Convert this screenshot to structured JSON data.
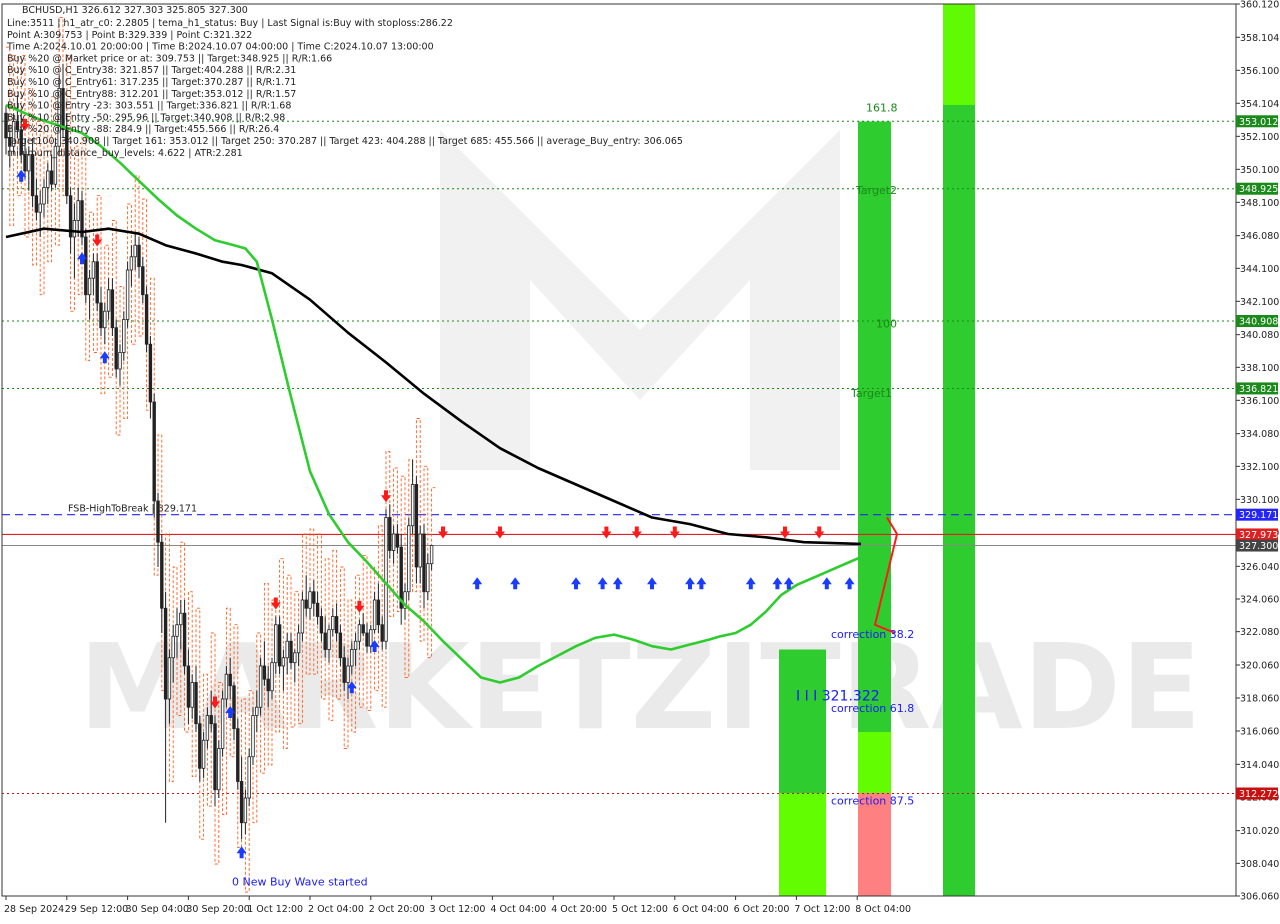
{
  "header": {
    "symbol_line": "BCHUSD,H1  326.612 327.303 325.805 327.300",
    "info_lines": [
      "Line:3511  |  h1_atr_c0: 2.2805  |  tema_h1_status: Buy  |  Last Signal is:Buy with stoploss:286.22",
      "Point A:309.753  |  Point B:329.339  |  Point C:321.322",
      "Time A:2024.10.01 20:00:00  |  Time B:2024.10.07 04:00:00  |  Time C:2024.10.07 13:00:00",
      "Buy %20 @ Market price or at: 309.753  ||  Target:348.925  ||  R/R:1.66",
      "Buy %10 @ C_Entry38: 321.857  ||  Target:404.288  ||  R/R:2.31",
      "Buy %10 @ C_Entry61: 317.235  ||  Target:370.287  ||  R/R:1.71",
      "Buy %10 @ C_Entry88: 312.201  ||  Target:353.012  ||  R/R:1.57",
      "Buy %10 @ Entry -23: 303.551  ||  Target:336.821  ||  R/R:1.68",
      "Buy %10 @ Entry -50: 295.96  ||  Target:340.908  ||  R/R:2.98",
      "Buy %20 @ Entry -88: 284.9  ||  Target:455.566  ||  R/R:26.4",
      "Target100: 340.908  ||  Target 161: 353.012  ||  Target 250: 370.287  ||  Target 423: 404.288  ||  Target 685: 455.566  ||  average_Buy_entry: 306.065",
      "minimum_distance_buy_levels: 4.622  |  ATR:2.281"
    ]
  },
  "colors": {
    "up_candle": "#222222",
    "down_candle": "#222222",
    "ma_slow": "#000000",
    "ma_fast": "#2ecc2e",
    "stop_line": "#ff6020",
    "buy_arrow": "#1a3cff",
    "sell_arrow": "#ff1a1a",
    "level_green": "#1a8a1a",
    "level_red": "#c81010",
    "fsb_line": "#2424ff",
    "current_line": "#888888",
    "zone_green": "#2ecc2e",
    "zone_lime": "#66ff00",
    "zone_pink": "#ff8080",
    "watermark": "#d8d8d8"
  },
  "watermark": "MARKETZITRADE",
  "chart_data": {
    "type": "candlestick",
    "symbol": "BCHUSD",
    "timeframe": "H1",
    "ohlc_last": {
      "open": 326.612,
      "high": 327.303,
      "low": 325.805,
      "close": 327.3
    },
    "ylim": [
      306.06,
      360.12
    ],
    "y_ticks": [
      360.12,
      358.104,
      356.1,
      354.104,
      352.1,
      350.1,
      348.1,
      346.08,
      344.1,
      342.1,
      340.08,
      338.1,
      336.1,
      334.08,
      332.1,
      330.1,
      328.1,
      326.04,
      324.06,
      322.08,
      320.06,
      318.06,
      316.06,
      314.04,
      312.06,
      310.02,
      308.04,
      306.06
    ],
    "y_tick_labels": [
      "360.120",
      "358.104",
      "356.100",
      "354.104",
      "352.100",
      "350.100",
      "348.100",
      "346.080",
      "344.100",
      "342.100",
      "340.080",
      "338.100",
      "336.100",
      "334.080",
      "332.100",
      "330.100",
      "328.100",
      "326.040",
      "324.060",
      "322.080",
      "320.060",
      "318.060",
      "316.060",
      "314.040",
      "312.060",
      "310.020",
      "308.040",
      "306.060"
    ],
    "x_labels": [
      "28 Sep 2024",
      "29 Sep 12:00",
      "30 Sep 04:00",
      "30 Sep 20:00",
      "1 Oct 12:00",
      "2 Oct 04:00",
      "2 Oct 20:00",
      "3 Oct 12:00",
      "4 Oct 04:00",
      "4 Oct 20:00",
      "5 Oct 12:00",
      "6 Oct 04:00",
      "6 Oct 20:00",
      "7 Oct 12:00",
      "8 Oct 04:00"
    ],
    "x_label_positions": [
      0,
      16,
      32,
      48,
      64,
      80,
      96,
      112,
      128,
      144,
      160,
      176,
      192,
      208,
      224
    ],
    "candles": [
      [
        353.5,
        354.0,
        351.0,
        352.0
      ],
      [
        352.0,
        352.8,
        350.2,
        351.5
      ],
      [
        351.5,
        353.5,
        351.0,
        353.0
      ],
      [
        353.0,
        354.6,
        352.0,
        352.5
      ],
      [
        352.5,
        353.5,
        350.5,
        351.0
      ],
      [
        351.0,
        352.0,
        349.5,
        350.0
      ],
      [
        350.0,
        351.5,
        348.8,
        351.0
      ],
      [
        351.0,
        352.0,
        347.8,
        348.5
      ],
      [
        348.5,
        349.5,
        347.0,
        347.5
      ],
      [
        347.5,
        348.8,
        346.0,
        348.0
      ],
      [
        348.0,
        349.5,
        347.2,
        349.0
      ],
      [
        349.0,
        350.5,
        348.0,
        350.0
      ],
      [
        350.0,
        351.0,
        348.8,
        349.2
      ],
      [
        349.2,
        352.0,
        349.0,
        351.5
      ],
      [
        351.5,
        355.8,
        351.0,
        355.0
      ],
      [
        355.0,
        356.5,
        352.0,
        352.5
      ],
      [
        352.5,
        353.5,
        348.0,
        348.5
      ],
      [
        348.5,
        349.0,
        345.0,
        346.0
      ],
      [
        346.0,
        348.0,
        343.5,
        347.0
      ],
      [
        347.0,
        349.0,
        346.0,
        348.2
      ],
      [
        348.2,
        348.8,
        345.5,
        346.0
      ],
      [
        346.0,
        346.5,
        342.0,
        342.5
      ],
      [
        342.5,
        344.0,
        341.0,
        343.5
      ],
      [
        343.5,
        345.0,
        342.5,
        344.5
      ],
      [
        344.5,
        345.0,
        341.5,
        342.0
      ],
      [
        342.0,
        343.0,
        340.0,
        340.5
      ],
      [
        340.5,
        342.0,
        339.5,
        341.5
      ],
      [
        341.5,
        343.5,
        341.0,
        342.8
      ],
      [
        342.8,
        343.5,
        340.0,
        340.5
      ],
      [
        340.5,
        341.0,
        337.5,
        338.0
      ],
      [
        338.0,
        339.5,
        337.0,
        339.0
      ],
      [
        339.0,
        341.5,
        338.5,
        341.0
      ],
      [
        341.0,
        344.5,
        340.5,
        344.0
      ],
      [
        344.0,
        345.5,
        343.0,
        344.8
      ],
      [
        344.8,
        346.2,
        344.0,
        345.5
      ],
      [
        345.5,
        346.0,
        343.5,
        344.2
      ],
      [
        344.2,
        344.8,
        342.0,
        342.5
      ],
      [
        342.5,
        343.0,
        339.0,
        339.5
      ],
      [
        339.5,
        340.0,
        335.0,
        336.0
      ],
      [
        336.0,
        336.5,
        329.0,
        330.0
      ],
      [
        330.0,
        330.5,
        326.0,
        327.5
      ],
      [
        327.5,
        328.0,
        322.0,
        323.5
      ],
      [
        323.5,
        324.5,
        310.5,
        318.0
      ],
      [
        318.0,
        321.0,
        316.5,
        320.5
      ],
      [
        320.5,
        322.5,
        319.0,
        321.8
      ],
      [
        321.8,
        323.5,
        320.5,
        322.5
      ],
      [
        322.5,
        324.0,
        321.0,
        323.2
      ],
      [
        323.2,
        324.0,
        319.5,
        320.0
      ],
      [
        320.0,
        321.0,
        316.5,
        317.5
      ],
      [
        317.5,
        319.5,
        316.8,
        319.0
      ],
      [
        319.0,
        320.0,
        316.0,
        316.5
      ],
      [
        316.5,
        317.0,
        313.0,
        313.8
      ],
      [
        313.8,
        316.0,
        313.2,
        315.5
      ],
      [
        315.5,
        317.5,
        315.0,
        317.0
      ],
      [
        317.0,
        318.5,
        316.0,
        316.5
      ],
      [
        316.5,
        317.0,
        311.5,
        312.5
      ],
      [
        312.5,
        315.5,
        312.0,
        315.0
      ],
      [
        315.0,
        318.5,
        314.5,
        318.0
      ],
      [
        318.0,
        320.0,
        317.5,
        319.5
      ],
      [
        319.5,
        320.5,
        318.0,
        318.8
      ],
      [
        318.8,
        319.0,
        315.5,
        316.2
      ],
      [
        316.2,
        316.8,
        312.5,
        313.0
      ],
      [
        313.0,
        314.5,
        309.5,
        310.5
      ],
      [
        310.5,
        312.5,
        309.8,
        312.0
      ],
      [
        312.0,
        315.0,
        311.5,
        314.5
      ],
      [
        314.5,
        317.5,
        314.0,
        317.0
      ],
      [
        317.0,
        318.5,
        316.0,
        317.5
      ],
      [
        317.5,
        320.5,
        317.0,
        320.0
      ],
      [
        320.0,
        321.5,
        318.8,
        319.2
      ],
      [
        319.2,
        320.0,
        317.5,
        318.5
      ],
      [
        318.5,
        320.5,
        318.0,
        320.2
      ],
      [
        320.2,
        323.0,
        319.5,
        322.5
      ],
      [
        322.5,
        323.0,
        319.5,
        320.0
      ],
      [
        320.0,
        321.0,
        318.5,
        320.5
      ],
      [
        320.5,
        322.0,
        319.5,
        321.5
      ],
      [
        321.5,
        322.0,
        319.8,
        320.2
      ],
      [
        320.2,
        321.0,
        319.0,
        320.8
      ],
      [
        320.8,
        322.5,
        320.0,
        322.0
      ],
      [
        322.0,
        324.5,
        321.5,
        324.0
      ],
      [
        324.0,
        325.5,
        323.0,
        323.5
      ],
      [
        323.5,
        324.8,
        322.8,
        324.5
      ],
      [
        324.5,
        325.2,
        323.0,
        323.8
      ],
      [
        323.8,
        324.5,
        322.5,
        323.0
      ],
      [
        323.0,
        323.5,
        321.5,
        322.0
      ],
      [
        322.0,
        323.0,
        320.5,
        321.0
      ],
      [
        321.0,
        322.5,
        320.2,
        322.2
      ],
      [
        322.2,
        323.5,
        321.8,
        323.0
      ],
      [
        323.0,
        323.8,
        321.5,
        322.0
      ],
      [
        322.0,
        322.5,
        320.0,
        320.5
      ],
      [
        320.5,
        321.2,
        318.5,
        319.0
      ],
      [
        319.0,
        320.5,
        318.0,
        320.0
      ],
      [
        320.0,
        321.5,
        319.5,
        321.0
      ],
      [
        321.0,
        322.0,
        320.0,
        321.5
      ],
      [
        321.5,
        322.8,
        321.0,
        322.5
      ],
      [
        322.5,
        323.2,
        321.8,
        322.0
      ],
      [
        322.0,
        322.6,
        320.8,
        321.2
      ],
      [
        321.2,
        322.5,
        320.8,
        322.2
      ],
      [
        322.2,
        324.5,
        322.0,
        324.0
      ],
      [
        324.0,
        325.0,
        322.0,
        322.5
      ],
      [
        322.5,
        323.0,
        321.0,
        321.5
      ],
      [
        321.5,
        329.5,
        321.0,
        329.0
      ],
      [
        329.0,
        329.8,
        326.5,
        327.0
      ],
      [
        327.0,
        328.5,
        326.2,
        328.0
      ],
      [
        328.0,
        328.6,
        326.8,
        327.2
      ],
      [
        327.2,
        328.0,
        322.5,
        323.5
      ],
      [
        323.5,
        325.0,
        322.8,
        324.5
      ],
      [
        324.5,
        329.0,
        324.0,
        328.5
      ],
      [
        328.5,
        332.5,
        328.0,
        331.0
      ],
      [
        331.0,
        331.5,
        325.0,
        326.0
      ],
      [
        326.0,
        328.5,
        325.0,
        328.0
      ],
      [
        328.0,
        328.6,
        323.5,
        324.5
      ],
      [
        324.5,
        326.8,
        324.0,
        326.2
      ],
      [
        326.2,
        327.303,
        325.805,
        327.3
      ]
    ],
    "ma_slow_points": [
      [
        0,
        346.0
      ],
      [
        10,
        346.5
      ],
      [
        20,
        346.3
      ],
      [
        27,
        346.5
      ],
      [
        35,
        346.2
      ],
      [
        42,
        345.5
      ],
      [
        50,
        345.0
      ],
      [
        57,
        344.5
      ],
      [
        62,
        344.3
      ],
      [
        70,
        343.8
      ],
      [
        80,
        342.2
      ],
      [
        90,
        340.2
      ],
      [
        100,
        338.4
      ],
      [
        110,
        336.5
      ],
      [
        120,
        334.8
      ],
      [
        130,
        333.2
      ],
      [
        140,
        332.0
      ],
      [
        150,
        331.0
      ],
      [
        160,
        330.0
      ],
      [
        170,
        329.0
      ],
      [
        180,
        328.6
      ],
      [
        190,
        328.0
      ],
      [
        200,
        327.8
      ],
      [
        210,
        327.5
      ],
      [
        225,
        327.4
      ]
    ],
    "ma_fast_points": [
      [
        0,
        354.0
      ],
      [
        8,
        353.2
      ],
      [
        16,
        352.6
      ],
      [
        20,
        352.3
      ],
      [
        25,
        351.5
      ],
      [
        30,
        350.5
      ],
      [
        35,
        349.4
      ],
      [
        40,
        348.3
      ],
      [
        45,
        347.3
      ],
      [
        50,
        346.5
      ],
      [
        55,
        345.8
      ],
      [
        60,
        345.5
      ],
      [
        63,
        345.3
      ],
      [
        66,
        344.5
      ],
      [
        70,
        341.0
      ],
      [
        75,
        336.3
      ],
      [
        80,
        331.8
      ],
      [
        85,
        329.2
      ],
      [
        90,
        327.5
      ],
      [
        95,
        326.3
      ],
      [
        100,
        325.0
      ],
      [
        105,
        323.7
      ],
      [
        110,
        322.7
      ],
      [
        115,
        321.5
      ],
      [
        120,
        320.4
      ],
      [
        125,
        319.3
      ],
      [
        130,
        319.0
      ],
      [
        135,
        319.3
      ],
      [
        140,
        320.0
      ],
      [
        145,
        320.6
      ],
      [
        150,
        321.2
      ],
      [
        155,
        321.7
      ],
      [
        160,
        321.9
      ],
      [
        165,
        321.6
      ],
      [
        170,
        321.2
      ],
      [
        175,
        321.0
      ],
      [
        180,
        321.3
      ],
      [
        185,
        321.6
      ],
      [
        188,
        321.8
      ],
      [
        192,
        322.0
      ],
      [
        196,
        322.5
      ],
      [
        200,
        323.3
      ],
      [
        204,
        324.3
      ],
      [
        208,
        324.9
      ],
      [
        212,
        325.3
      ],
      [
        215,
        325.6
      ],
      [
        218,
        325.9
      ],
      [
        222,
        326.3
      ],
      [
        225,
        326.6
      ]
    ],
    "levels": [
      {
        "price": 353.012,
        "label": "353.012",
        "kind": "target"
      },
      {
        "price": 348.925,
        "label": "348.925",
        "kind": "target"
      },
      {
        "price": 340.908,
        "label": "340.908",
        "kind": "target"
      },
      {
        "price": 336.821,
        "label": "336.821",
        "kind": "target"
      },
      {
        "price": 312.272,
        "label": "312.272",
        "kind": "stop"
      }
    ],
    "fsb_level": {
      "price": 329.171,
      "label": "329.171",
      "text": "FSB-HighToBreak | 329.171"
    },
    "red_level": {
      "price": 327.973,
      "label": "327.973"
    },
    "current_price": {
      "price": 327.3,
      "label": "327.300"
    },
    "annotations": [
      {
        "text": "161.8",
        "price": 353.6,
        "color": "#1a8a1a"
      },
      {
        "text": "Target2",
        "price": 348.6,
        "color": "#1a8a1a"
      },
      {
        "text": "100",
        "price": 340.5,
        "color": "#1a8a1a"
      },
      {
        "text": "Target1",
        "price": 336.3,
        "color": "#1a8a1a"
      },
      {
        "text": "correction 38.2",
        "price": 321.7,
        "color": "#1a1aff"
      },
      {
        "text": "I I I 321.322",
        "price": 317.9,
        "color": "#1a1aff"
      },
      {
        "text": "correction 61.8",
        "price": 317.2,
        "color": "#1a1aff"
      },
      {
        "text": "correction 87.5",
        "price": 311.6,
        "color": "#1a1aff"
      },
      {
        "text": "0 New Buy Wave started",
        "price": 306.7,
        "color": "#1a1aff"
      }
    ]
  }
}
